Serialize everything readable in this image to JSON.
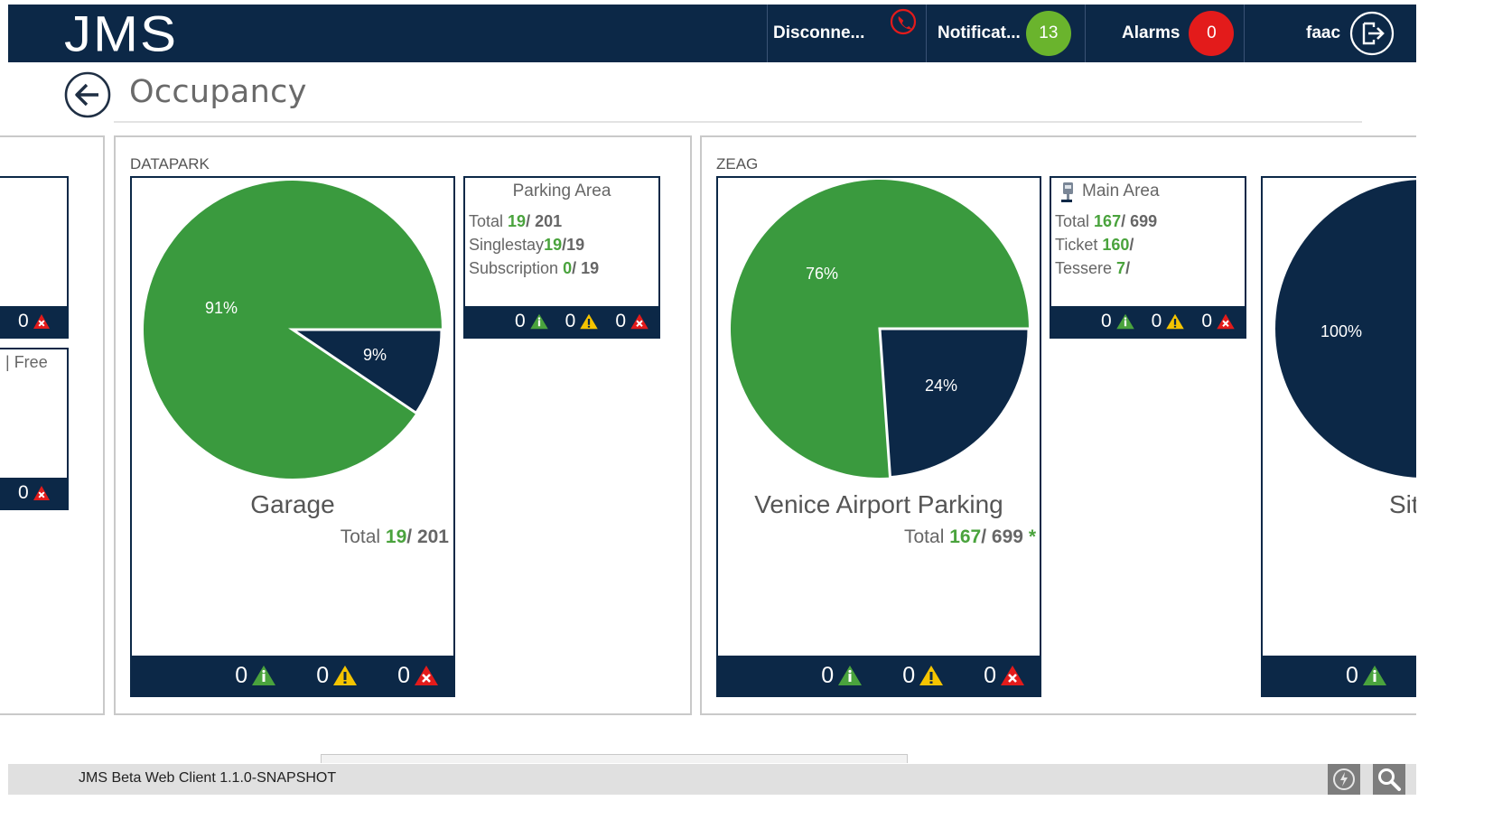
{
  "app": {
    "logo": "JMS"
  },
  "header": {
    "connection_label": "Disconne...",
    "notifications_label": "Notificat...",
    "notifications_count": "13",
    "alarms_label": "Alarms",
    "alarms_count": "0",
    "user_name": "faac"
  },
  "page": {
    "title": "Occupancy"
  },
  "left_partial": {
    "card1_count": "0",
    "card2_label": "Free",
    "card2_count": "0"
  },
  "groups": [
    {
      "label": "DATAPARK",
      "site": {
        "name": "Garage",
        "total_label": "Total",
        "total_used": "19",
        "total_capacity": "201",
        "occupied_pct_label": "9%",
        "free_pct_label": "91%",
        "occupied_fraction": 0.0945,
        "counts": {
          "info": "0",
          "warning": "0",
          "error": "0"
        }
      },
      "area": {
        "title": "Parking Area",
        "lines": [
          {
            "label": "Total",
            "used": "19",
            "capacity": "201"
          },
          {
            "label": "Singlestay",
            "used": "19",
            "capacity": "19"
          },
          {
            "label": "Subscription",
            "used": "0",
            "capacity": "19"
          }
        ],
        "counts": {
          "info": "0",
          "warning": "0",
          "error": "0"
        }
      }
    },
    {
      "label": "ZEAG",
      "site": {
        "name": "Venice Airport Parking",
        "total_label": "Total",
        "total_used": "167",
        "total_capacity": "699",
        "asterisk": "*",
        "occupied_pct_label": "24%",
        "free_pct_label": "76%",
        "occupied_fraction": 0.2389,
        "counts": {
          "info": "0",
          "warning": "0",
          "error": "0"
        }
      },
      "area": {
        "title": "Main Area",
        "icon": "parking-meter-icon",
        "lines": [
          {
            "label": "Total",
            "used": "167",
            "capacity": "699"
          },
          {
            "label": "Ticket",
            "used": "160",
            "capacity": ""
          },
          {
            "label": "Tessere",
            "used": "7",
            "capacity": ""
          }
        ],
        "counts": {
          "info": "0",
          "warning": "0",
          "error": "0"
        }
      },
      "partial_site": {
        "name_fragment": "Sit",
        "occupied_pct_label": "100%",
        "occupied_fraction": 1.0,
        "info_count": "0"
      }
    }
  ],
  "status_bar": {
    "version_text": "JMS Beta Web Client 1.1.0-SNAPSHOT"
  },
  "colors": {
    "navy": "#0c2847",
    "free_green": "#3a9a3e",
    "badge_green": "#6ab42d",
    "badge_red": "#e31b1b",
    "info_green": "#4aa33d",
    "warning_yellow": "#f5c400",
    "error_red": "#e31b1b"
  }
}
